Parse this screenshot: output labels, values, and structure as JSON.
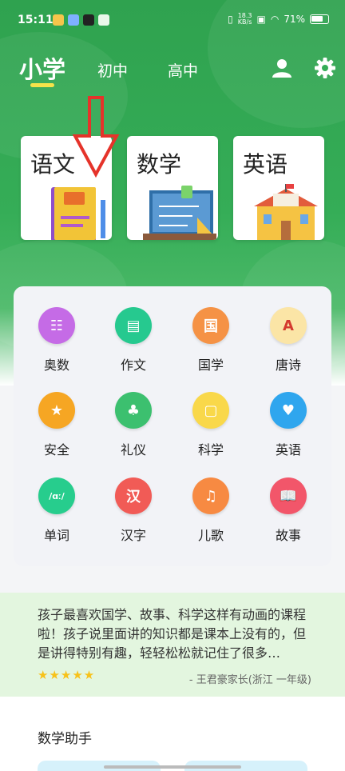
{
  "status_bar": {
    "time": "15:11",
    "net_speed_top": "18.3",
    "net_speed_bottom": "KB/s",
    "battery": "71%"
  },
  "tabs": [
    {
      "label": "小学",
      "active": true
    },
    {
      "label": "初中",
      "active": false
    },
    {
      "label": "高中",
      "active": false
    }
  ],
  "header_icons": [
    "user-icon",
    "gear-icon"
  ],
  "subjects": [
    {
      "title": "语文",
      "art": "book-icon"
    },
    {
      "title": "数学",
      "art": "math-board-icon"
    },
    {
      "title": "英语",
      "art": "school-building-icon"
    }
  ],
  "grid": [
    {
      "label": "奥数",
      "glyph": "☷",
      "color": "#c56be6"
    },
    {
      "label": "作文",
      "glyph": "▤",
      "color": "#26c98f"
    },
    {
      "label": "国学",
      "glyph": "国",
      "color": "#f59245"
    },
    {
      "label": "唐诗",
      "glyph": "A",
      "color": "#fbe5a6"
    },
    {
      "label": "安全",
      "glyph": "★",
      "color": "#f6a623"
    },
    {
      "label": "礼仪",
      "glyph": "♣",
      "color": "#3cc06f"
    },
    {
      "label": "科学",
      "glyph": "▢",
      "color": "#f9d84a"
    },
    {
      "label": "英语",
      "glyph": "♥",
      "color": "#2fa6ee"
    },
    {
      "label": "单词",
      "glyph": "/ɑː/",
      "color": "#27cd8d"
    },
    {
      "label": "汉字",
      "glyph": "汉",
      "color": "#f15b56"
    },
    {
      "label": "儿歌",
      "glyph": "♫",
      "color": "#f78a42"
    },
    {
      "label": "故事",
      "glyph": "📖",
      "color": "#f2566a"
    }
  ],
  "review": {
    "text": "孩子最喜欢国学、故事、科学这样有动画的课程啦！孩子说里面讲的知识都是课本上没有的，但是讲得特别有趣，轻轻松松就记住了很多…",
    "stars": "★★★★★",
    "author": "- 王君豪家长(浙江 一年级)"
  },
  "helper": {
    "title": "数学助手"
  }
}
